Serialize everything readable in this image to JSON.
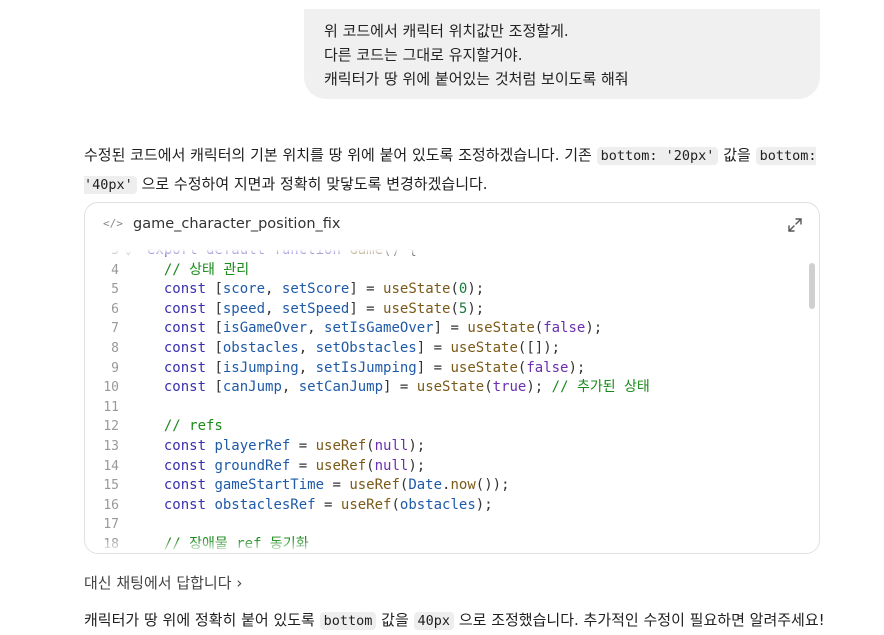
{
  "user_message": {
    "lines": [
      "위 코드에서 캐릭터 위치값만 조정할게.",
      "다른 코드는 그대로 유지할거야.",
      "캐릭터가 땅 위에 붙어있는 것처럼 보이도록 해줘"
    ]
  },
  "assistant_intro": {
    "part1": "수정된 코드에서 캐릭터의 기본 위치를 땅 위에 붙어 있도록 조정하겠습니다. 기존 ",
    "code1": "bottom: '20px'",
    "part2": " 값을 ",
    "code2": "bottom: '40px'",
    "part3": " 으로 수정하여 지면과 정확히 맞닿도록 변경하겠습니다."
  },
  "artifact": {
    "title": "game_character_position_fix",
    "code_icon": "</>",
    "expand_icon": "expand-icon"
  },
  "code_lines": [
    {
      "n": "3",
      "fold": "⌄",
      "tokens": [
        [
          "kw",
          "export "
        ],
        [
          "kw",
          "default "
        ],
        [
          "kw",
          "function "
        ],
        [
          "fn",
          "Game"
        ],
        [
          "",
          "() {"
        ]
      ]
    },
    {
      "n": "4",
      "tokens": [
        [
          "",
          "  "
        ],
        [
          "cm",
          "// 상태 관리"
        ]
      ]
    },
    {
      "n": "5",
      "tokens": [
        [
          "",
          "  "
        ],
        [
          "kw",
          "const "
        ],
        [
          "",
          "["
        ],
        [
          "var",
          "score"
        ],
        [
          "",
          ", "
        ],
        [
          "var",
          "setScore"
        ],
        [
          "",
          "] = "
        ],
        [
          "fn",
          "useState"
        ],
        [
          "",
          "("
        ],
        [
          "num",
          "0"
        ],
        [
          "",
          ");"
        ]
      ]
    },
    {
      "n": "6",
      "tokens": [
        [
          "",
          "  "
        ],
        [
          "kw",
          "const "
        ],
        [
          "",
          "["
        ],
        [
          "var",
          "speed"
        ],
        [
          "",
          ", "
        ],
        [
          "var",
          "setSpeed"
        ],
        [
          "",
          "] = "
        ],
        [
          "fn",
          "useState"
        ],
        [
          "",
          "("
        ],
        [
          "num",
          "5"
        ],
        [
          "",
          ");"
        ]
      ]
    },
    {
      "n": "7",
      "tokens": [
        [
          "",
          "  "
        ],
        [
          "kw",
          "const "
        ],
        [
          "",
          "["
        ],
        [
          "var",
          "isGameOver"
        ],
        [
          "",
          ", "
        ],
        [
          "var",
          "setIsGameOver"
        ],
        [
          "",
          "] = "
        ],
        [
          "fn",
          "useState"
        ],
        [
          "",
          "("
        ],
        [
          "bool",
          "false"
        ],
        [
          "",
          ");"
        ]
      ]
    },
    {
      "n": "8",
      "tokens": [
        [
          "",
          "  "
        ],
        [
          "kw",
          "const "
        ],
        [
          "",
          "["
        ],
        [
          "var",
          "obstacles"
        ],
        [
          "",
          ", "
        ],
        [
          "var",
          "setObstacles"
        ],
        [
          "",
          "] = "
        ],
        [
          "fn",
          "useState"
        ],
        [
          "",
          "([]);"
        ]
      ]
    },
    {
      "n": "9",
      "tokens": [
        [
          "",
          "  "
        ],
        [
          "kw",
          "const "
        ],
        [
          "",
          "["
        ],
        [
          "var",
          "isJumping"
        ],
        [
          "",
          ", "
        ],
        [
          "var",
          "setIsJumping"
        ],
        [
          "",
          "] = "
        ],
        [
          "fn",
          "useState"
        ],
        [
          "",
          "("
        ],
        [
          "bool",
          "false"
        ],
        [
          "",
          ");"
        ]
      ]
    },
    {
      "n": "10",
      "tokens": [
        [
          "",
          "  "
        ],
        [
          "kw",
          "const "
        ],
        [
          "",
          "["
        ],
        [
          "var",
          "canJump"
        ],
        [
          "",
          ", "
        ],
        [
          "var",
          "setCanJump"
        ],
        [
          "",
          "] = "
        ],
        [
          "fn",
          "useState"
        ],
        [
          "",
          "("
        ],
        [
          "bool",
          "true"
        ],
        [
          "",
          "); "
        ],
        [
          "cm",
          "// 추가된 상태"
        ]
      ]
    },
    {
      "n": "11",
      "tokens": []
    },
    {
      "n": "12",
      "tokens": [
        [
          "",
          "  "
        ],
        [
          "cm",
          "// refs"
        ]
      ]
    },
    {
      "n": "13",
      "tokens": [
        [
          "",
          "  "
        ],
        [
          "kw",
          "const "
        ],
        [
          "var",
          "playerRef"
        ],
        [
          "",
          " = "
        ],
        [
          "fn",
          "useRef"
        ],
        [
          "",
          "("
        ],
        [
          "bool",
          "null"
        ],
        [
          "",
          ");"
        ]
      ]
    },
    {
      "n": "14",
      "tokens": [
        [
          "",
          "  "
        ],
        [
          "kw",
          "const "
        ],
        [
          "var",
          "groundRef"
        ],
        [
          "",
          " = "
        ],
        [
          "fn",
          "useRef"
        ],
        [
          "",
          "("
        ],
        [
          "bool",
          "null"
        ],
        [
          "",
          ");"
        ]
      ]
    },
    {
      "n": "15",
      "tokens": [
        [
          "",
          "  "
        ],
        [
          "kw",
          "const "
        ],
        [
          "var",
          "gameStartTime"
        ],
        [
          "",
          " = "
        ],
        [
          "fn",
          "useRef"
        ],
        [
          "",
          "("
        ],
        [
          "var",
          "Date"
        ],
        [
          "",
          "."
        ],
        [
          "fn",
          "now"
        ],
        [
          "",
          "());"
        ]
      ]
    },
    {
      "n": "16",
      "tokens": [
        [
          "",
          "  "
        ],
        [
          "kw",
          "const "
        ],
        [
          "var",
          "obstaclesRef"
        ],
        [
          "",
          " = "
        ],
        [
          "fn",
          "useRef"
        ],
        [
          "",
          "("
        ],
        [
          "var",
          "obstacles"
        ],
        [
          "",
          ");"
        ]
      ]
    },
    {
      "n": "17",
      "tokens": []
    },
    {
      "n": "18",
      "tokens": [
        [
          "",
          "  "
        ],
        [
          "cm",
          "// 장애물 ref 동기화"
        ]
      ]
    }
  ],
  "link": {
    "label": "대신 채팅에서 답합니다",
    "chevron": "›"
  },
  "final_message": {
    "part1": "캐릭터가 땅 위에 정확히 붙어 있도록 ",
    "code1": "bottom",
    "part2": " 값을 ",
    "code2": "40px",
    "part3": " 으로 조정했습니다. 추가적인 수정이 필요하면 알려주세요!"
  }
}
